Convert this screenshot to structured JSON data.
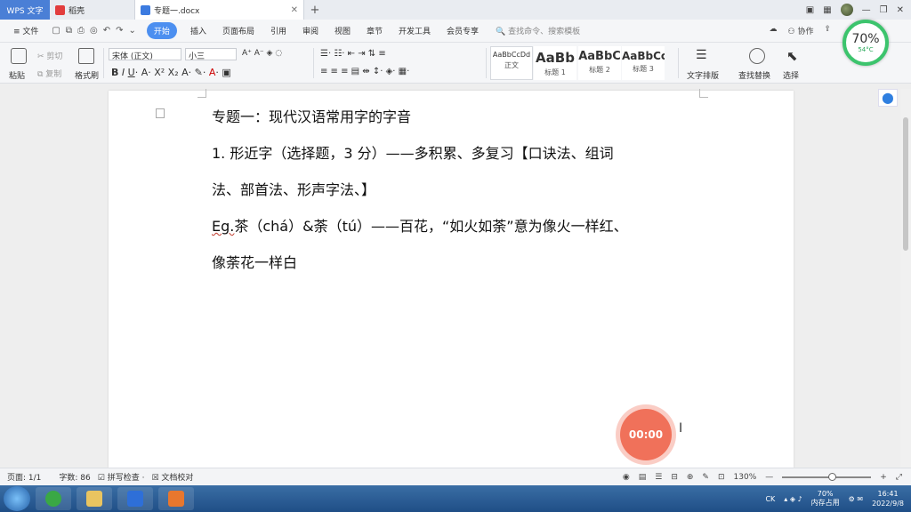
{
  "tabbar": {
    "app_name": "WPS 文字",
    "tabs": [
      {
        "label": "稻壳",
        "color": "#e23d3d"
      },
      {
        "label": "专题一.docx",
        "color": "#3c7be0"
      }
    ],
    "add_tab": "+"
  },
  "menubar": {
    "file": "文件",
    "items": [
      "开始",
      "插入",
      "页面布局",
      "引用",
      "审阅",
      "视图",
      "章节",
      "开发工具",
      "会员专享"
    ],
    "active": "开始",
    "search_placeholder": "查找命令、搜索模板",
    "right": [
      "协作"
    ]
  },
  "ribbon": {
    "paste": "粘贴",
    "cut": "剪切",
    "copy": "复制",
    "format_painter": "格式刷",
    "font_name": "宋体 (正文)",
    "font_size": "小三",
    "styles": [
      {
        "sample": "AaBbCcDd",
        "name": "正文"
      },
      {
        "sample": "AaBb",
        "name": "标题 1"
      },
      {
        "sample": "AaBbC",
        "name": "标题 2"
      },
      {
        "sample": "AaBbCc",
        "name": "标题 3"
      }
    ],
    "text_layout": "文字排版",
    "find_replace": "查找替换",
    "select": "选择"
  },
  "perf": {
    "percent": "70%",
    "temp": "54°C"
  },
  "document": {
    "lines": [
      "专题一：现代汉语常用字的字音",
      "1. 形近字（选择题，3 分）——多积累、多复习【口诀法、组词",
      "法、部首法、形声字法、】",
      "茶（chá）&荼（tú）——百花，“如火如荼”意为像火一样红、",
      "像荼花一样白"
    ],
    "eg_prefix": "Eg."
  },
  "recorder": {
    "time": "00:00"
  },
  "statusbar": {
    "page": "页面: 1/1",
    "words": "字数: 86",
    "spell_check": "拼写检查",
    "doc_proof": "文档校对",
    "zoom": "130%"
  },
  "taskbar": {
    "memory_pct": "70%",
    "memory_label": "内存占用",
    "ime": "CK",
    "time": "16:41",
    "date": "2022/9/8"
  }
}
